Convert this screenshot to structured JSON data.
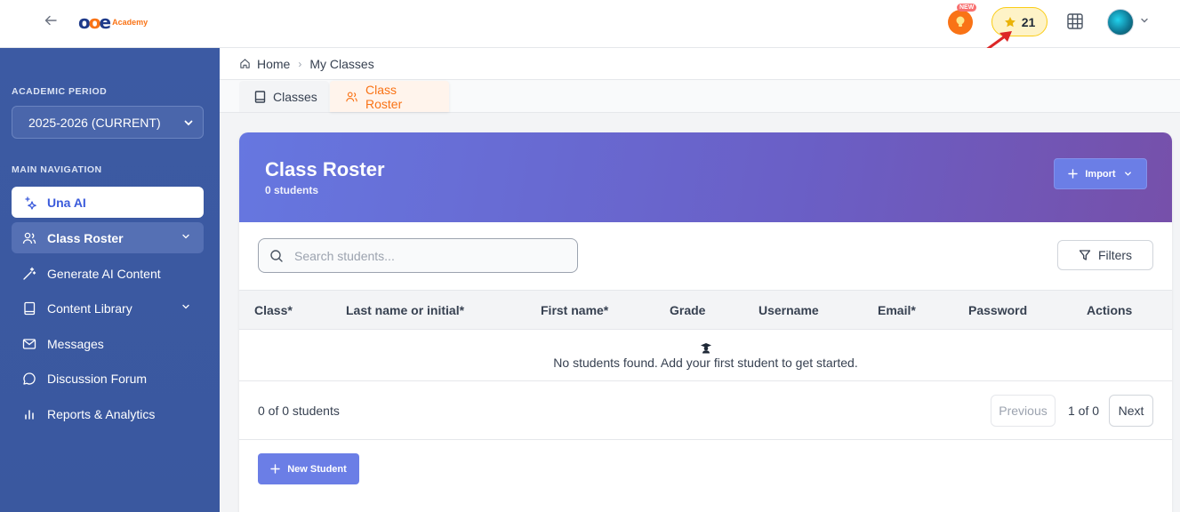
{
  "topbar": {
    "logo_text": "Academy",
    "new_badge": "NEW",
    "points": "21"
  },
  "sidebar": {
    "academic_period_label": "ACADEMIC PERIOD",
    "academic_period_value": "2025-2026 (CURRENT)",
    "main_nav_label": "MAIN NAVIGATION",
    "items": [
      {
        "label": "Una AI",
        "icon": "sparkle-icon"
      },
      {
        "label": "Class Roster",
        "icon": "users-icon"
      },
      {
        "label": "Generate AI Content",
        "icon": "magic-wand-icon"
      },
      {
        "label": "Content Library",
        "icon": "book-icon"
      },
      {
        "label": "Messages",
        "icon": "mail-icon"
      },
      {
        "label": "Discussion Forum",
        "icon": "chat-bubble-icon"
      },
      {
        "label": "Reports & Analytics",
        "icon": "bar-chart-icon"
      }
    ]
  },
  "breadcrumb": {
    "home": "Home",
    "current": "My Classes"
  },
  "tabs": {
    "classes": "Classes",
    "roster": "Class Roster"
  },
  "hero": {
    "title": "Class Roster",
    "subtitle": "0 students",
    "import_label": "Import"
  },
  "search": {
    "placeholder": "Search students..."
  },
  "filters_label": "Filters",
  "table": {
    "columns": [
      "Class*",
      "Last name or initial*",
      "First name*",
      "Grade",
      "Username",
      "Email*",
      "Password",
      "Actions"
    ],
    "empty_message": "No students found. Add your first student to get started."
  },
  "pagination": {
    "count": "0 of 0 students",
    "previous": "Previous",
    "page": "1 of 0",
    "next": "Next"
  },
  "new_student_label": "New Student",
  "colors": {
    "sidebar": "#3c5aa3",
    "accent": "#6b7ee6",
    "orange": "#f97316"
  }
}
